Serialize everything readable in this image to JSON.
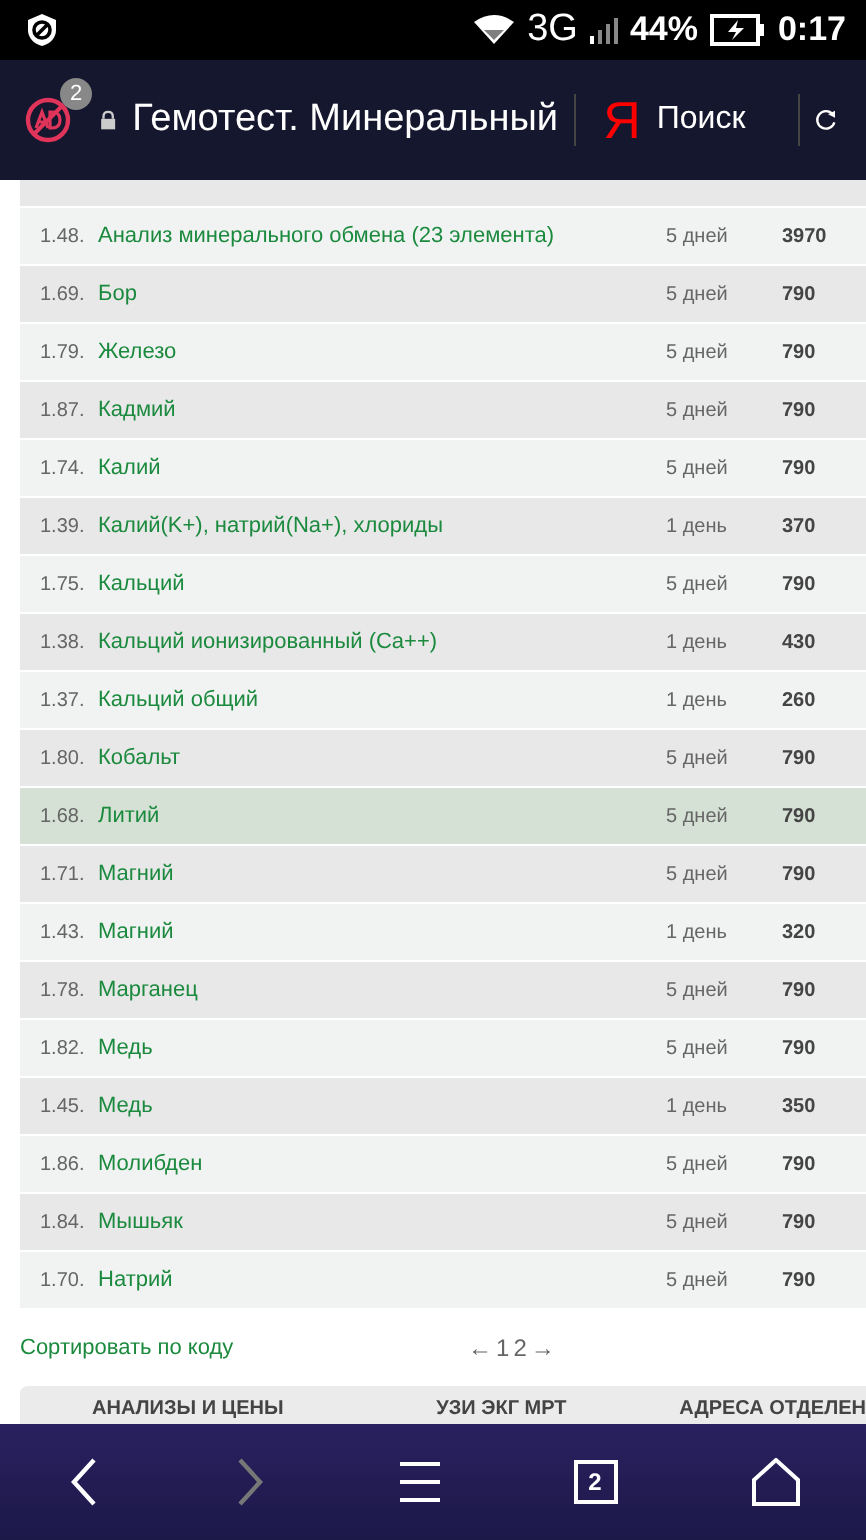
{
  "status_bar": {
    "network": "3G",
    "battery": "44%",
    "time": "0:17"
  },
  "browser_bar": {
    "blocked_badge": "2",
    "title": "Гемотест. Минеральный",
    "search_logo": "Я",
    "search_label": "Поиск"
  },
  "tests": [
    {
      "code": "1.48.",
      "name": "Анализ минерального обмена (23 элемента)",
      "duration": "5 дней",
      "price": "3970",
      "selected": false
    },
    {
      "code": "1.69.",
      "name": "Бор",
      "duration": "5 дней",
      "price": "790",
      "selected": false
    },
    {
      "code": "1.79.",
      "name": "Железо",
      "duration": "5 дней",
      "price": "790",
      "selected": false
    },
    {
      "code": "1.87.",
      "name": "Кадмий",
      "duration": "5 дней",
      "price": "790",
      "selected": false
    },
    {
      "code": "1.74.",
      "name": "Калий",
      "duration": "5 дней",
      "price": "790",
      "selected": false
    },
    {
      "code": "1.39.",
      "name": "Калий(K+), натрий(Na+), хлориды",
      "duration": "1 день",
      "price": "370",
      "selected": false
    },
    {
      "code": "1.75.",
      "name": "Кальций",
      "duration": "5 дней",
      "price": "790",
      "selected": false
    },
    {
      "code": "1.38.",
      "name": "Кальций ионизированный (Ca++)",
      "duration": "1 день",
      "price": "430",
      "selected": false
    },
    {
      "code": "1.37.",
      "name": "Кальций общий",
      "duration": "1 день",
      "price": "260",
      "selected": false
    },
    {
      "code": "1.80.",
      "name": "Кобальт",
      "duration": "5 дней",
      "price": "790",
      "selected": false
    },
    {
      "code": "1.68.",
      "name": "Литий",
      "duration": "5 дней",
      "price": "790",
      "selected": true
    },
    {
      "code": "1.71.",
      "name": "Магний",
      "duration": "5 дней",
      "price": "790",
      "selected": false
    },
    {
      "code": "1.43.",
      "name": "Магний",
      "duration": "1 день",
      "price": "320",
      "selected": false
    },
    {
      "code": "1.78.",
      "name": "Марганец",
      "duration": "5 дней",
      "price": "790",
      "selected": false
    },
    {
      "code": "1.82.",
      "name": "Медь",
      "duration": "5 дней",
      "price": "790",
      "selected": false
    },
    {
      "code": "1.45.",
      "name": "Медь",
      "duration": "1 день",
      "price": "350",
      "selected": false
    },
    {
      "code": "1.86.",
      "name": "Молибден",
      "duration": "5 дней",
      "price": "790",
      "selected": false
    },
    {
      "code": "1.84.",
      "name": "Мышьяк",
      "duration": "5 дней",
      "price": "790",
      "selected": false
    },
    {
      "code": "1.70.",
      "name": "Натрий",
      "duration": "5 дней",
      "price": "790",
      "selected": false
    }
  ],
  "sort_link": "Сортировать по коду",
  "pagination": {
    "prev": "←",
    "pages": [
      "1",
      "2"
    ],
    "next": "→"
  },
  "site_menu": [
    "АНАЛИЗЫ И ЦЕНЫ",
    "УЗИ ЭКГ МРТ",
    "АДРЕСА ОТДЕЛЕН"
  ],
  "nav_bar": {
    "tabs_count": "2"
  }
}
